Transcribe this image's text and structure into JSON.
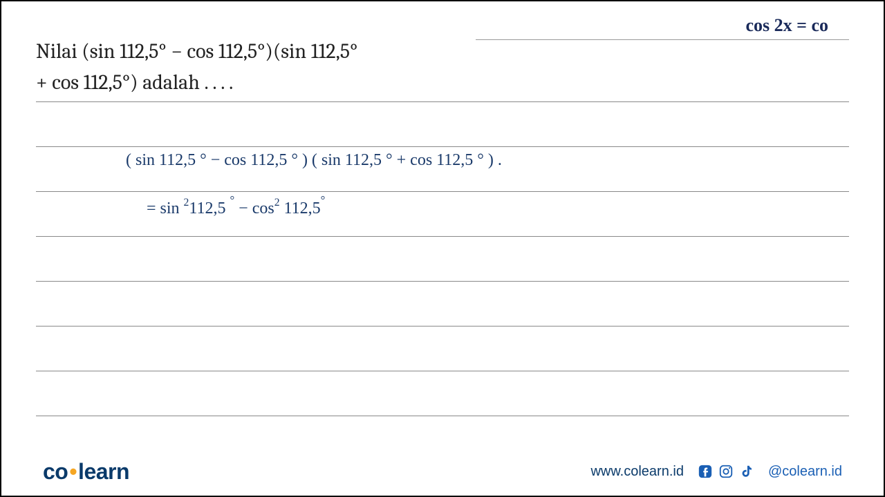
{
  "problem": {
    "line1": "Nilai (sin 112,5° −  cos 112,5°)(sin 112,5°",
    "line2": "+  cos 112,5°) adalah . . . ."
  },
  "formula_note": "cos 2x  =  co",
  "handwritten": {
    "step1": "( sin  112,5 °  −   cos 112,5 ° ) (  sin 112,5 ° +  cos  112,5 ° ) .",
    "step2_prefix": "=        sin ",
    "step2_exp1": "2",
    "step2_mid1": "112,5 ",
    "step2_deg1": "°",
    "step2_mid2": "   −   cos",
    "step2_exp2": "2",
    "step2_mid3": " 112,5",
    "step2_deg2": "°"
  },
  "footer": {
    "logo_part1": "co",
    "logo_part2": "learn",
    "website": "www.colearn.id",
    "handle": "@colearn.id"
  }
}
